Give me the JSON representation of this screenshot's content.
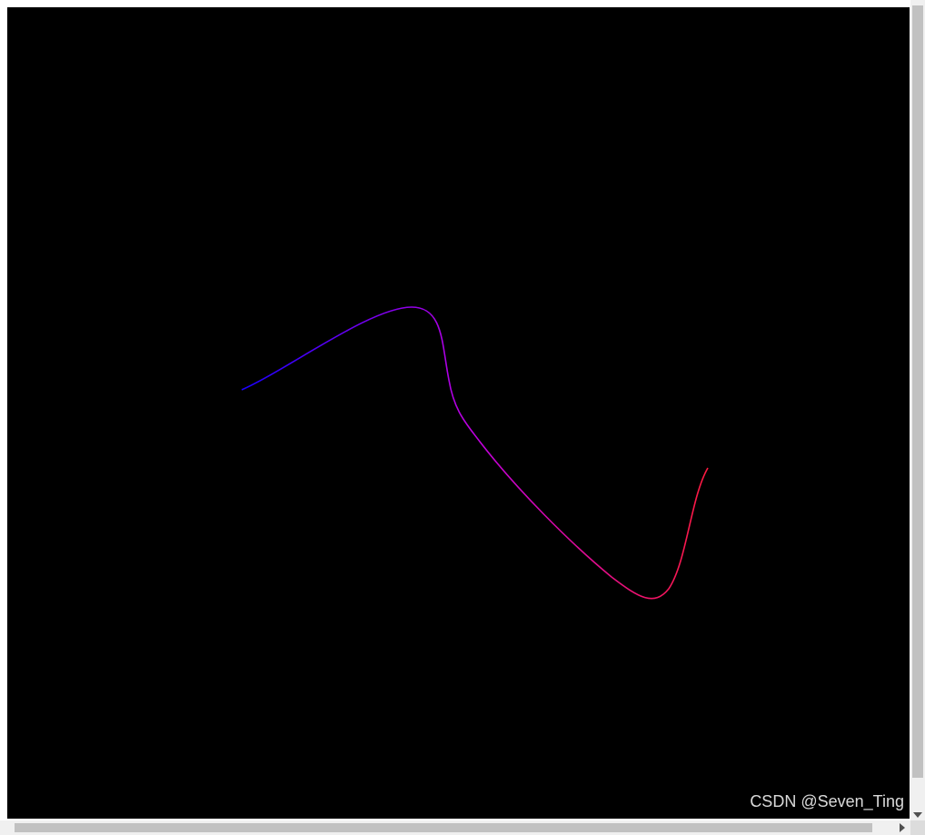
{
  "canvas": {
    "background": "#000000",
    "curve_start_color": "#1a00ff",
    "curve_mid_color": "#c000e0",
    "curve_end_color": "#ff1a40"
  },
  "watermark": {
    "text": "CSDN @Seven_Ting"
  },
  "scrollbars": {
    "track_color": "#f0f0f0",
    "thumb_color": "#c1c1c1"
  }
}
